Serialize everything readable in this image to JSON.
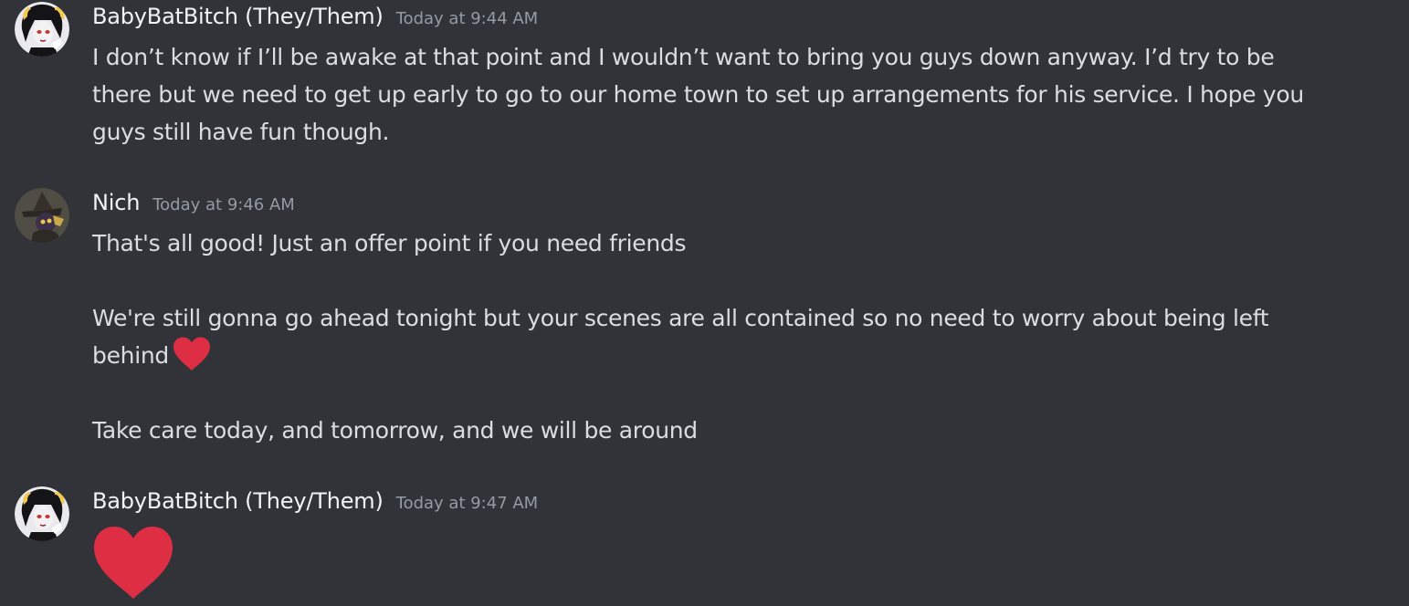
{
  "messages": [
    {
      "username": "BabyBatBitch (They/Them)",
      "timestamp": "Today at 9:44 AM",
      "avatar": "gothic-girl-avatar",
      "lines": [
        "I don’t know if I’ll be awake at that point and I wouldn’t want to bring you guys down anyway. I’d try to be",
        "there but we need to get up early to go to our home town to set up arrangements for his service. I hope you",
        "guys still have fun though."
      ]
    },
    {
      "username": "Nich",
      "timestamp": "Today at 9:46 AM",
      "avatar": "witch-hat-character-avatar",
      "paragraphs": {
        "p1": "That's all good! Just an offer point if you need friends",
        "p2_line1": "We're still gonna go ahead tonight but your scenes are all contained so no need to worry about being left",
        "p2_line2": "behind",
        "p2_emoji": "heart-emoji",
        "p3": "Take care today, and tomorrow, and we will be around"
      }
    },
    {
      "username": "BabyBatBitch (They/Them)",
      "timestamp": "Today at 9:47 AM",
      "avatar": "gothic-girl-avatar",
      "emoji": "heart-emoji"
    }
  ],
  "colors": {
    "background": "#313338",
    "username": "#f2f3f5",
    "timestamp": "#949ba4",
    "text": "#dbdee1",
    "heart": "#dd2e44"
  }
}
